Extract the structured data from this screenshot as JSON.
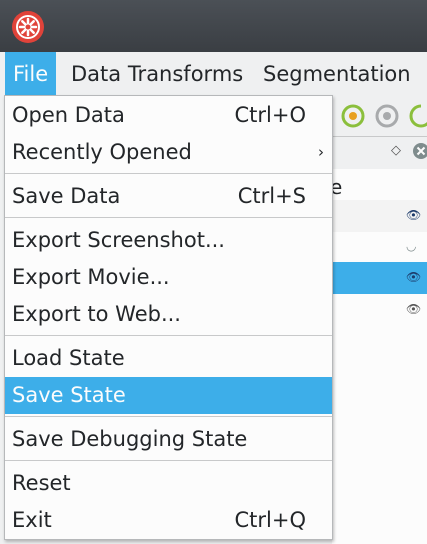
{
  "menubar": {
    "items": [
      "File",
      "Data Transforms",
      "Segmentation"
    ]
  },
  "background": {
    "partial_label": "e"
  },
  "file_menu": {
    "open_data": {
      "label": "Open Data",
      "shortcut": "Ctrl+O"
    },
    "recently_opened": {
      "label": "Recently Opened",
      "arrow": "›"
    },
    "save_data": {
      "label": "Save Data",
      "shortcut": "Ctrl+S"
    },
    "export_screenshot": {
      "label": "Export Screenshot..."
    },
    "export_movie": {
      "label": "Export Movie..."
    },
    "export_to_web": {
      "label": "Export to Web..."
    },
    "load_state": {
      "label": "Load State"
    },
    "save_state": {
      "label": "Save State"
    },
    "save_debugging_state": {
      "label": "Save Debugging State"
    },
    "reset": {
      "label": "Reset"
    },
    "exit": {
      "label": "Exit",
      "shortcut": "Ctrl+Q"
    }
  },
  "colors": {
    "accent": "#3daee9",
    "titlebar": "#3a3e43",
    "logo": "#e0433a"
  }
}
